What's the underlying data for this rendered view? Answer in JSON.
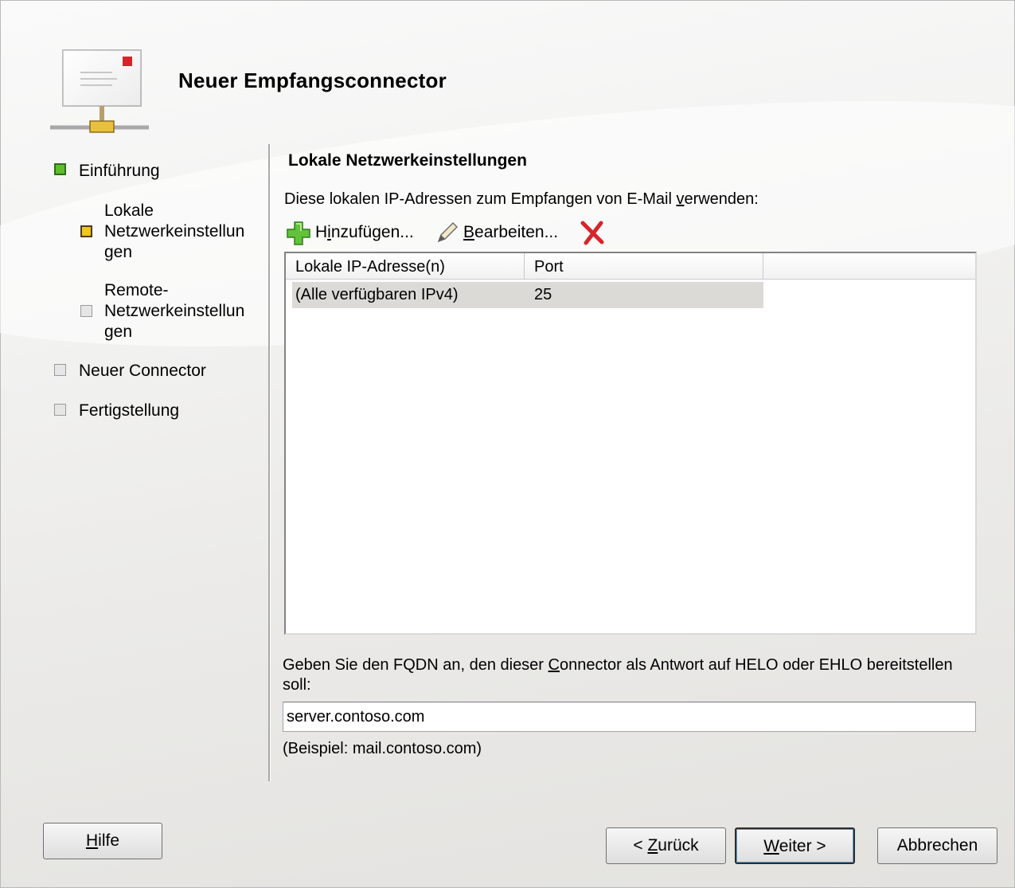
{
  "window": {
    "title": "Neuer Empfangsconnector"
  },
  "steps": [
    {
      "label": "Einführung",
      "state": "done"
    },
    {
      "label": "Lokale Netzwerkeinstellungen",
      "lines": [
        "Lokale",
        "Netzwerkeinstellun",
        "gen"
      ],
      "state": "current"
    },
    {
      "label": "Remote-Netzwerkeinstellungen",
      "lines": [
        "Remote-",
        "Netzwerkeinstellun",
        "gen"
      ],
      "state": "pending"
    },
    {
      "label": "Neuer Connector",
      "state": "pending"
    },
    {
      "label": "Fertigstellung",
      "state": "pending"
    }
  ],
  "page": {
    "heading": "Lokale Netzwerkeinstellungen",
    "instruction": {
      "before": "Diese lokalen IP-Adressen zum Empfangen von E-Mail ",
      "accel": "v",
      "after": "erwenden:"
    }
  },
  "toolbar": {
    "add": {
      "pre": "H",
      "accel": "i",
      "post": "nzufügen...",
      "icon": "add-icon"
    },
    "edit": {
      "pre": "",
      "accel": "B",
      "post": "earbeiten...",
      "icon": "pencil-icon"
    },
    "delete": {
      "icon": "delete-icon"
    }
  },
  "table": {
    "columns": [
      "Lokale IP-Adresse(n)",
      "Port"
    ],
    "rows": [
      {
        "ip": "(Alle verfügbaren IPv4)",
        "port": "25"
      }
    ]
  },
  "fqdn": {
    "label_before": "Geben Sie den FQDN an, den dieser ",
    "label_accel": "C",
    "label_after": "onnector als Antwort auf HELO oder EHLO bereitstellen soll:",
    "value": "server.contoso.com",
    "example": "(Beispiel: mail.contoso.com)"
  },
  "buttons": {
    "help": {
      "accel": "H",
      "rest": "ilfe"
    },
    "back": {
      "pre": "< ",
      "accel": "Z",
      "rest": "urück"
    },
    "next": {
      "accel": "W",
      "rest": "eiter >"
    },
    "cancel": {
      "label": "Abbrechen"
    }
  },
  "colors": {
    "done": "#5dbe2a",
    "current": "#f0c61b",
    "pending": "#e6e6e6",
    "delete": "#d8232a"
  }
}
